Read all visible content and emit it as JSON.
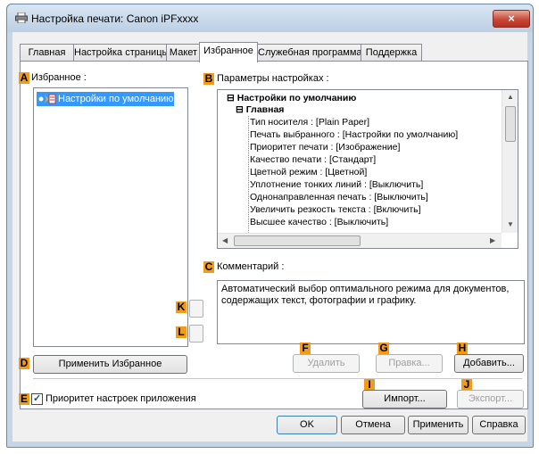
{
  "window": {
    "title": "Настройка печати: Canon iPFxxxx",
    "close_glyph": "×"
  },
  "tabs": [
    {
      "label": "Главная"
    },
    {
      "label": "Настройка страницы"
    },
    {
      "label": "Макет"
    },
    {
      "label": "Избранное",
      "active": true
    },
    {
      "label": "Служебная программа"
    },
    {
      "label": "Поддержка"
    }
  ],
  "badges": {
    "A": "A",
    "B": "B",
    "C": "C",
    "D": "D",
    "E": "E",
    "F": "F",
    "G": "G",
    "H": "H",
    "I": "I",
    "J": "J",
    "K": "K",
    "L": "L"
  },
  "favorites": {
    "label": "Избранное :",
    "items": [
      "Настройки по умолчанию"
    ]
  },
  "settings": {
    "label": "Параметры настройках :",
    "tree_root": "Настройки по умолчанию",
    "tree_group": "Главная",
    "tree_root_toggle": "⊟",
    "tree_group_toggle": "⊟",
    "items": [
      "Тип носителя : [Plain Paper]",
      "Печать выбранного : [Настройки по умолчанию]",
      "Приоритет печати : [Изображение]",
      "Качество печати : [Стандарт]",
      "Цветной режим : [Цветной]",
      "Уплотнение тонких линий : [Выключить]",
      "Однонаправленная печать : [Выключить]",
      "Увеличить резкость текста : [Включить]",
      "Высшее качество : [Выключить]"
    ]
  },
  "comment": {
    "label": "Комментарий :",
    "text_line1": "Автоматический выбор оптимального режима для документов,",
    "text_line2": "содержащих текст, фотографии и графику."
  },
  "buttons": {
    "apply_favorite": "Применить Избранное",
    "delete": "Удалить",
    "edit": "Правка...",
    "add": "Добавить...",
    "import": "Импорт...",
    "export": "Экспорт...",
    "ok": "OK",
    "cancel": "Отмена",
    "apply": "Применить",
    "help": "Справка"
  },
  "app_priority": {
    "label": "Приоритет настроек приложения",
    "checked": true,
    "check_glyph": "✓"
  },
  "colors": {
    "badge": "#f29b1a",
    "selection": "#3399ff",
    "close_button": "#c9483a"
  }
}
